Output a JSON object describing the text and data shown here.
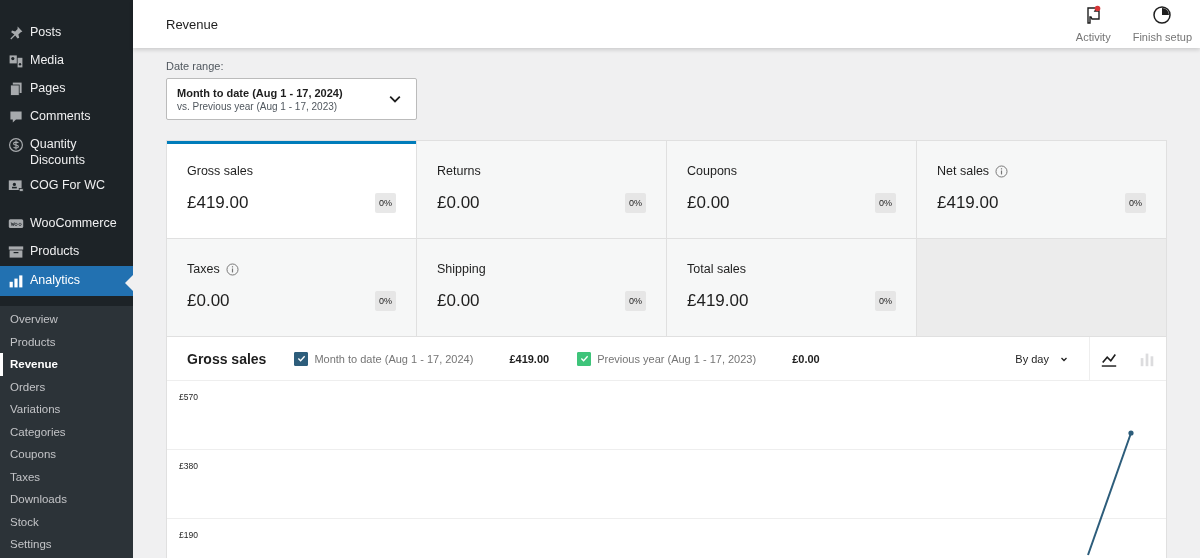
{
  "sidebar": {
    "items": [
      {
        "label": "Posts",
        "selected": false
      },
      {
        "label": "Media",
        "selected": false
      },
      {
        "label": "Pages",
        "selected": false
      },
      {
        "label": "Comments",
        "selected": false
      },
      {
        "label": "Quantity Discounts",
        "selected": false
      },
      {
        "label": "COG For WC",
        "selected": false
      },
      {
        "label": "WooCommerce",
        "selected": false
      },
      {
        "label": "Products",
        "selected": false
      },
      {
        "label": "Analytics",
        "selected": true,
        "children": [
          {
            "label": "Overview",
            "selected": false
          },
          {
            "label": "Products",
            "selected": false
          },
          {
            "label": "Revenue",
            "selected": true
          },
          {
            "label": "Orders",
            "selected": false
          },
          {
            "label": "Variations",
            "selected": false
          },
          {
            "label": "Categories",
            "selected": false
          },
          {
            "label": "Coupons",
            "selected": false
          },
          {
            "label": "Taxes",
            "selected": false
          },
          {
            "label": "Downloads",
            "selected": false
          },
          {
            "label": "Stock",
            "selected": false
          },
          {
            "label": "Settings",
            "selected": false
          }
        ]
      }
    ]
  },
  "header": {
    "title": "Revenue",
    "actions": [
      {
        "label": "Activity",
        "unread": true
      },
      {
        "label": "Finish setup",
        "unread": false
      }
    ]
  },
  "date_range": {
    "label": "Date range:",
    "primary": "Month to date (Aug 1 - 17, 2024)",
    "secondary": "vs. Previous year (Aug 1 - 17, 2023)"
  },
  "summary": [
    {
      "label": "Gross sales",
      "value": "£419.00",
      "delta": "0%",
      "info": false,
      "selected": true
    },
    {
      "label": "Returns",
      "value": "£0.00",
      "delta": "0%",
      "info": false,
      "selected": false
    },
    {
      "label": "Coupons",
      "value": "£0.00",
      "delta": "0%",
      "info": false,
      "selected": false
    },
    {
      "label": "Net sales",
      "value": "£419.00",
      "delta": "0%",
      "info": true,
      "selected": false
    },
    {
      "label": "Taxes",
      "value": "£0.00",
      "delta": "0%",
      "info": true,
      "selected": false
    },
    {
      "label": "Shipping",
      "value": "£0.00",
      "delta": "0%",
      "info": false,
      "selected": false
    },
    {
      "label": "Total sales",
      "value": "£419.00",
      "delta": "0%",
      "info": false,
      "selected": false
    }
  ],
  "chart": {
    "title": "Gross sales",
    "legend": [
      {
        "label": "Month to date (Aug 1 - 17, 2024)",
        "total": "£419.00",
        "checked": true,
        "color": "#2d5d7b"
      },
      {
        "label": "Previous year (Aug 1 - 17, 2023)",
        "total": "£0.00",
        "checked": true,
        "color": "#3ec47a"
      }
    ],
    "interval": "By day",
    "types": [
      {
        "kind": "line",
        "selected": true
      },
      {
        "kind": "bar",
        "selected": false
      }
    ],
    "y_labels": [
      "£570",
      "£380",
      "£190"
    ]
  }
}
